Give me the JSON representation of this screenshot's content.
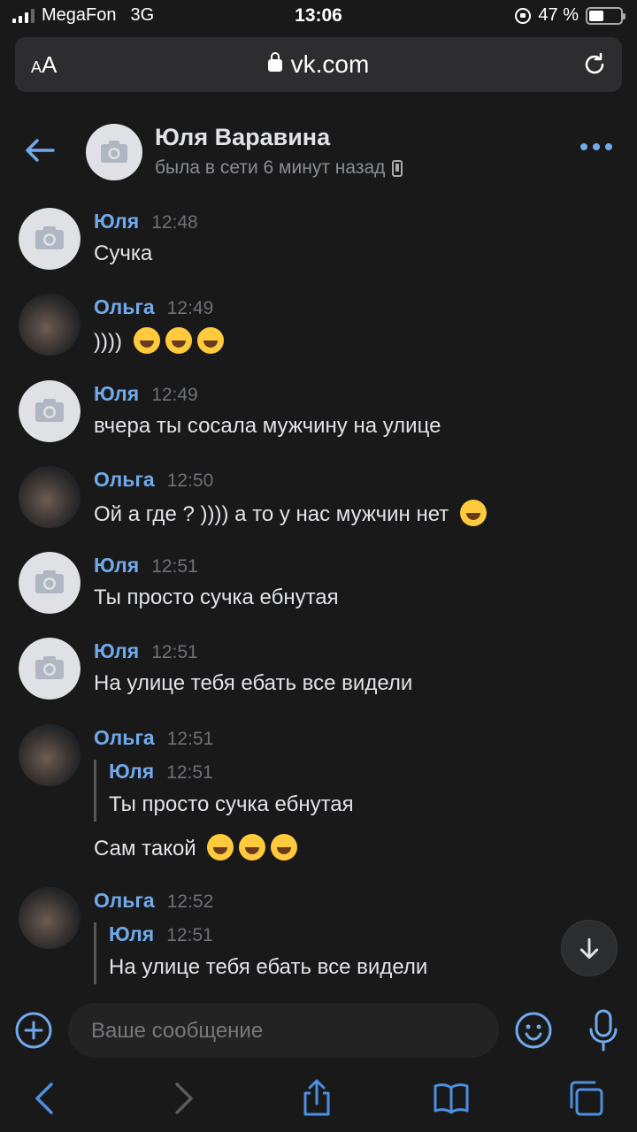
{
  "status_bar": {
    "carrier": "MegaFon",
    "network": "3G",
    "time": "13:06",
    "battery_percent": "47 %",
    "battery_level": 0.47
  },
  "browser": {
    "text_size_label": "AA",
    "url": "vk.com"
  },
  "chat": {
    "name": "Юля Варавина",
    "status": "была в сети 6 минут назад"
  },
  "messages": [
    {
      "author": "Юля",
      "time": "12:48",
      "text": "Сучка"
    },
    {
      "author": "Ольга",
      "time": "12:49",
      "text": "))))",
      "emoji_count": 3
    },
    {
      "author": "Юля",
      "time": "12:49",
      "text": "вчера ты сосала мужчину на улице"
    },
    {
      "author": "Ольга",
      "time": "12:50",
      "text": "Ой а где ? )))) а то у нас мужчин нет",
      "emoji_count": 1
    },
    {
      "author": "Юля",
      "time": "12:51",
      "text": "Ты просто сучка ебнутая"
    },
    {
      "author": "Юля",
      "time": "12:51",
      "text": "На улице тебя ебать все видели"
    },
    {
      "author": "Ольга",
      "time": "12:51",
      "reply": {
        "author": "Юля",
        "time": "12:51",
        "text": "Ты просто сучка ебнутая"
      },
      "text": "Сам такой",
      "emoji_count": 3
    },
    {
      "author": "Ольга",
      "time": "12:52",
      "reply": {
        "author": "Юля",
        "time": "12:51",
        "text": "На улице тебя ебать все видели"
      }
    }
  ],
  "composer": {
    "placeholder": "Ваше сообщение"
  },
  "colors": {
    "background": "#19191a",
    "accent": "#71aaeb",
    "text": "#e1e3e6",
    "muted": "#6d7075"
  },
  "icons": [
    "back-arrow-icon",
    "camera-icon",
    "more-dots-icon",
    "plus-circle-icon",
    "smile-icon",
    "mic-icon",
    "arrow-down-icon",
    "share-icon",
    "book-icon",
    "tabs-icon",
    "reload-icon",
    "lock-icon"
  ]
}
